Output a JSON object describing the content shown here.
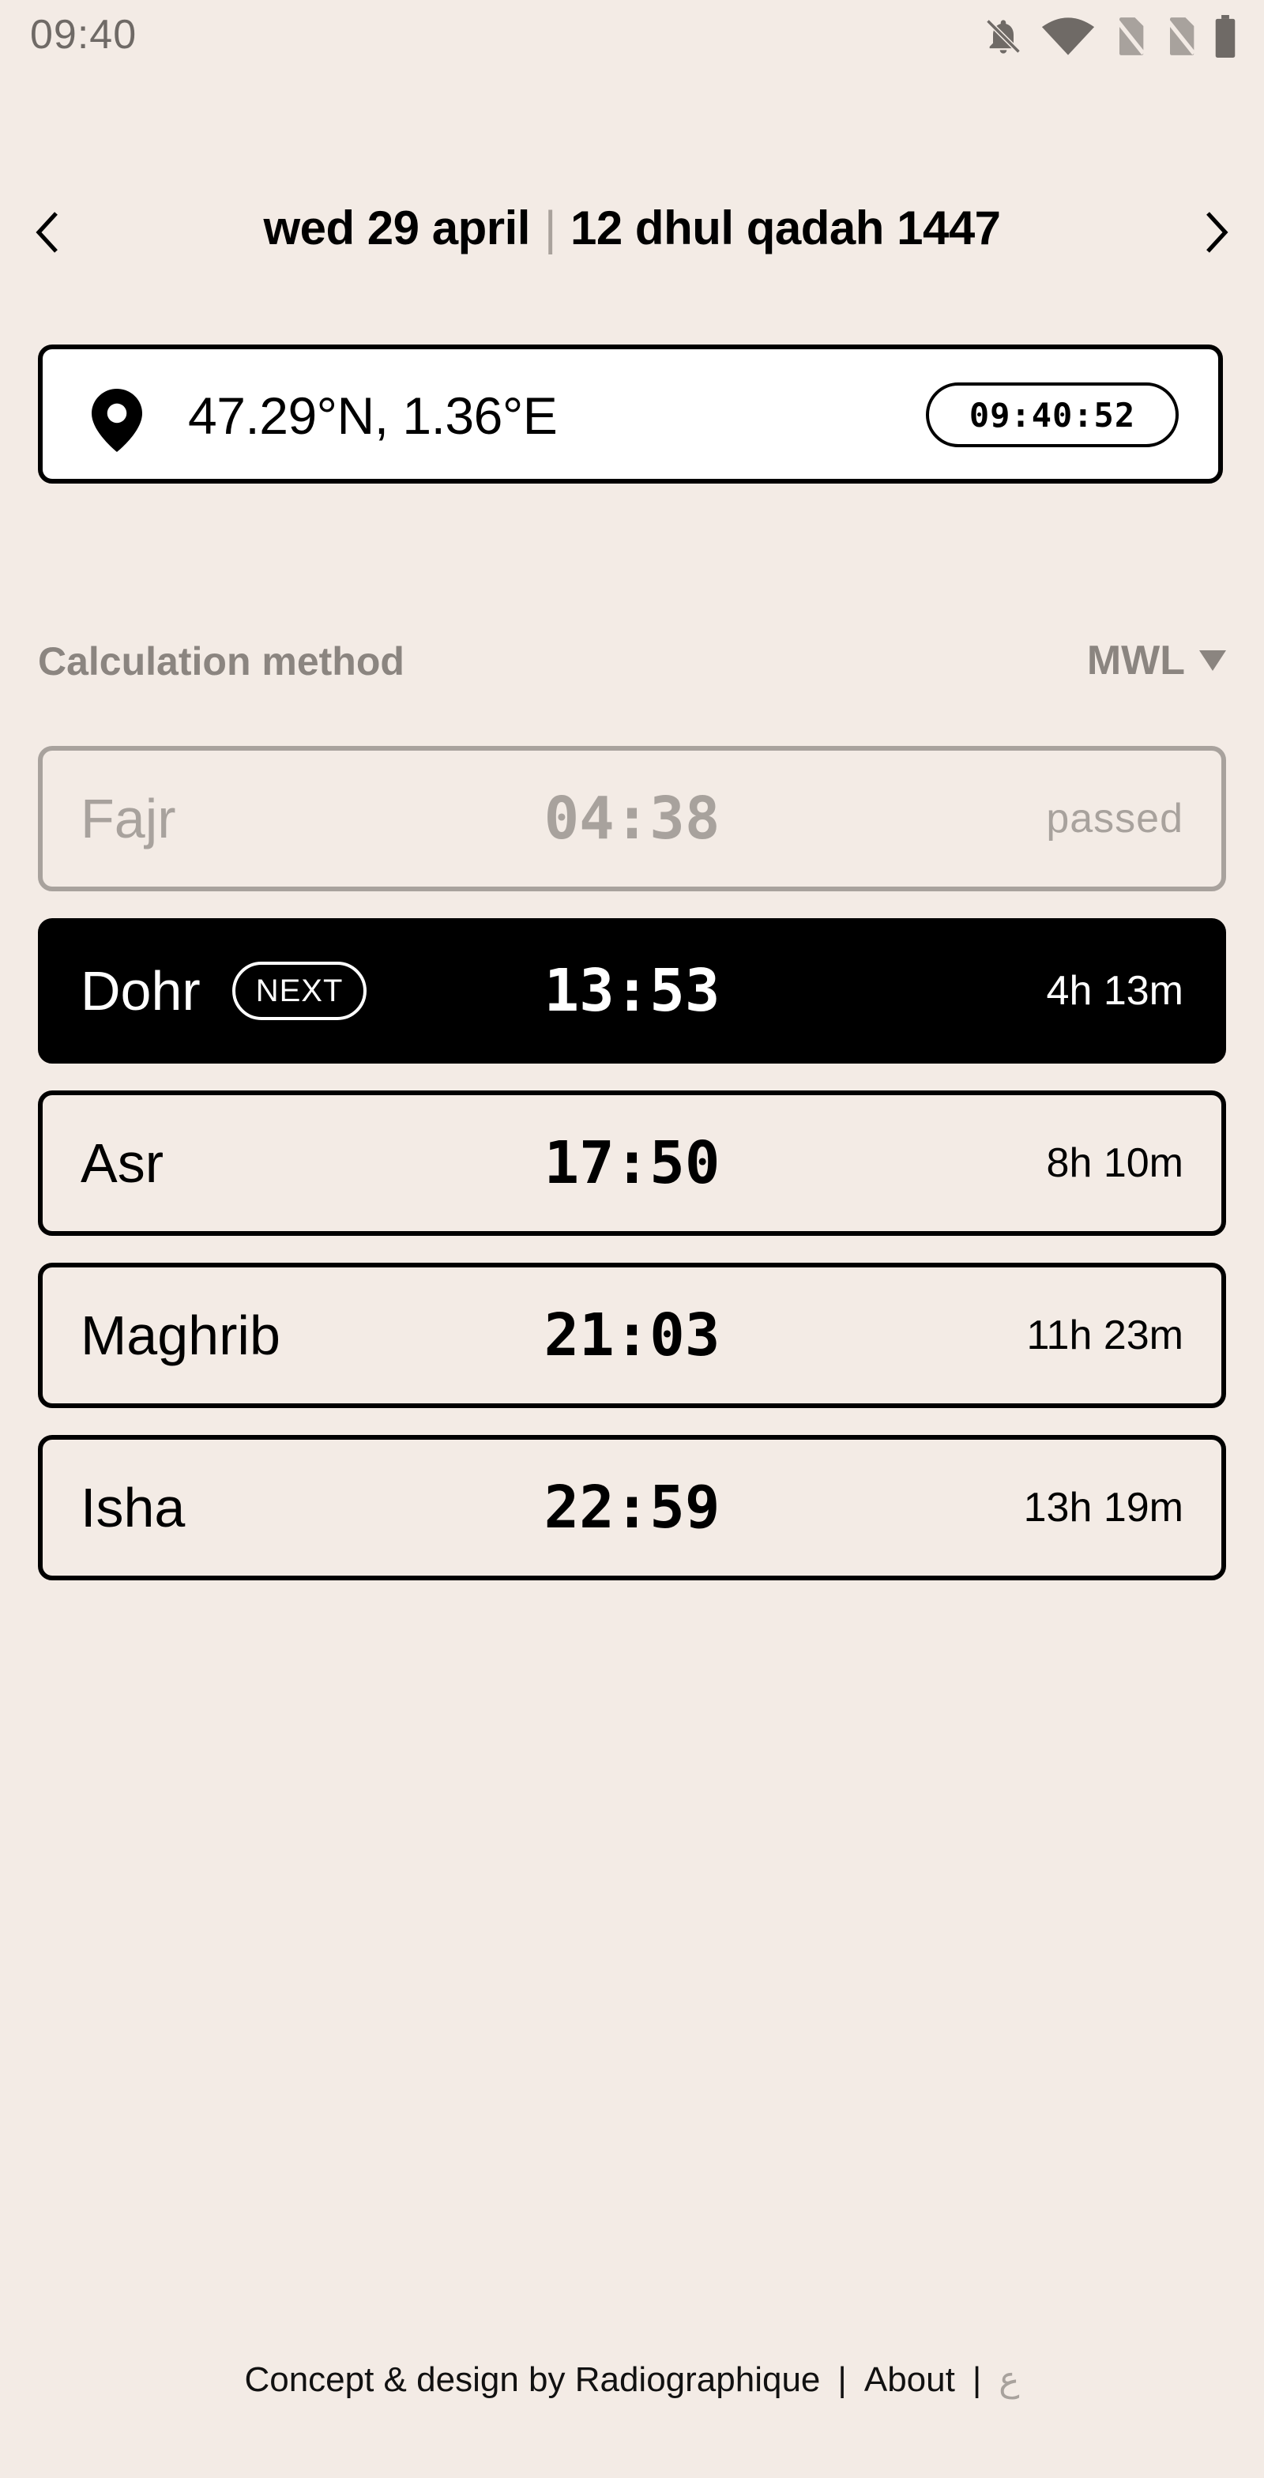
{
  "status_bar": {
    "time": "09:40",
    "icons": [
      "bell-off-icon",
      "wifi-icon",
      "no-sim-icon",
      "no-sim-icon",
      "battery-icon"
    ]
  },
  "date_nav": {
    "gregorian": "wed 29 april",
    "separator": "|",
    "hijri": "12 dhul qadah 1447"
  },
  "location": {
    "coordinates": "47.29°N, 1.36°E",
    "clock": "09:40:52"
  },
  "calculation": {
    "label": "Calculation method",
    "value": "MWL"
  },
  "prayers": [
    {
      "name": "Fajr",
      "time": "04:38",
      "remaining": "passed",
      "state": "passed"
    },
    {
      "name": "Dohr",
      "time": "13:53",
      "remaining": "4h 13m",
      "state": "next",
      "badge": "NEXT"
    },
    {
      "name": "Asr",
      "time": "17:50",
      "remaining": "8h 10m",
      "state": "upcoming"
    },
    {
      "name": "Maghrib",
      "time": "21:03",
      "remaining": "11h 23m",
      "state": "upcoming"
    },
    {
      "name": "Isha",
      "time": "22:59",
      "remaining": "13h 19m",
      "state": "upcoming"
    }
  ],
  "footer": {
    "credit": "Concept & design by Radiographique",
    "separator": "|",
    "about": "About",
    "language": "ع"
  },
  "colors": {
    "background": "#f3ebe5",
    "muted": "#8b8580",
    "passed": "#a8a29d",
    "accent": "#000000"
  }
}
